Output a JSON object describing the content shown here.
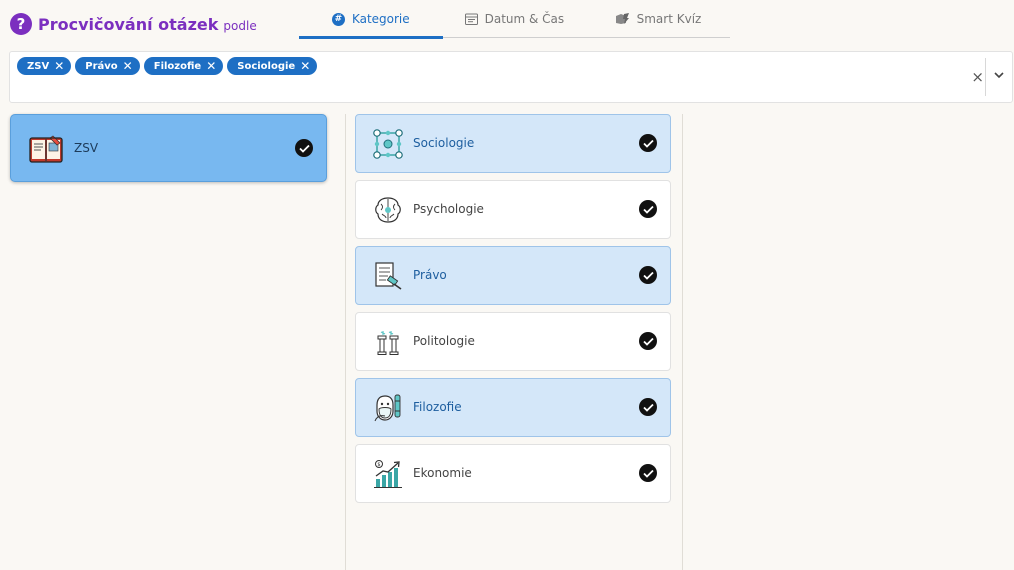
{
  "header": {
    "title": "Procvičování otázek",
    "title_suffix": "podle"
  },
  "tabs": [
    {
      "label": "Kategorie",
      "icon": "hash-icon",
      "active": true
    },
    {
      "label": "Datum & Čas",
      "icon": "calendar-icon",
      "active": false
    },
    {
      "label": "Smart Kvíz",
      "icon": "smart-quiz-icon",
      "active": false
    }
  ],
  "filter": {
    "chips": [
      {
        "label": "ZSV"
      },
      {
        "label": "Právo"
      },
      {
        "label": "Filozofie"
      },
      {
        "label": "Sociologie"
      }
    ],
    "clear_symbol": "×"
  },
  "main_category": {
    "label": "ZSV",
    "icon": "book-icon",
    "selected": true
  },
  "categories": [
    {
      "label": "Sociologie",
      "icon": "network-icon",
      "selected": true
    },
    {
      "label": "Psychologie",
      "icon": "brain-icon",
      "selected": false
    },
    {
      "label": "Právo",
      "icon": "law-document-icon",
      "selected": true
    },
    {
      "label": "Politologie",
      "icon": "columns-icon",
      "selected": false
    },
    {
      "label": "Filozofie",
      "icon": "philosopher-icon",
      "selected": true
    },
    {
      "label": "Ekonomie",
      "icon": "growth-chart-icon",
      "selected": false
    }
  ],
  "colors": {
    "accent": "#1e6fc4",
    "brand": "#7b2fbf",
    "selected_card": "#d4e7f9",
    "main_card": "#78b8f0"
  }
}
